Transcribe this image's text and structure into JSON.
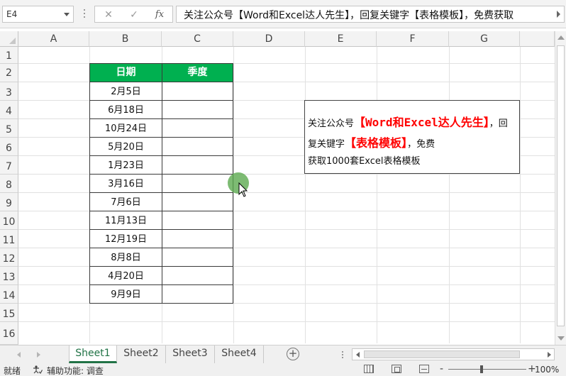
{
  "formula_bar": {
    "name_box": "E4",
    "cancel_icon": "✕",
    "enter_icon": "✓",
    "fx_icon": "fx",
    "formula_text": "关注公众号【Word和Excel达人先生】，回复关键字【表格模板】，免费获取"
  },
  "columns": [
    "A",
    "B",
    "C",
    "D",
    "E",
    "F",
    "G"
  ],
  "rows": [
    "1",
    "2",
    "3",
    "4",
    "5",
    "6",
    "7",
    "8",
    "9",
    "10",
    "11",
    "12",
    "13",
    "14",
    "15",
    "16"
  ],
  "table": {
    "headers": [
      "日期",
      "季度"
    ],
    "header_color": "#00b050",
    "dates": [
      "2月5日",
      "6月18日",
      "10月24日",
      "5月20日",
      "1月23日",
      "3月16日",
      "7月6日",
      "11月13日",
      "12月19日",
      "8月8日",
      "4月20日",
      "9月9日"
    ]
  },
  "textbox": {
    "prefix": "关注公众号",
    "bracket_open": "【",
    "bracket_close": "】",
    "highlight1": "Word和Excel达人先生",
    "middle": "，回复关键字",
    "highlight2": "表格模板",
    "suffix": "，免费",
    "line3": "获取1000套Excel表格模板",
    "highlight_color": "#ff0000"
  },
  "sheet_tabs": [
    "Sheet1",
    "Sheet2",
    "Sheet3",
    "Sheet4"
  ],
  "active_sheet": "Sheet1",
  "add_sheet_icon": "+",
  "status_bar": {
    "ready": "就绪",
    "accessibility": "辅助功能: 调查",
    "zoom_minus": "-",
    "zoom_plus": "+",
    "zoom": "100%"
  },
  "accent_color": "#217346"
}
